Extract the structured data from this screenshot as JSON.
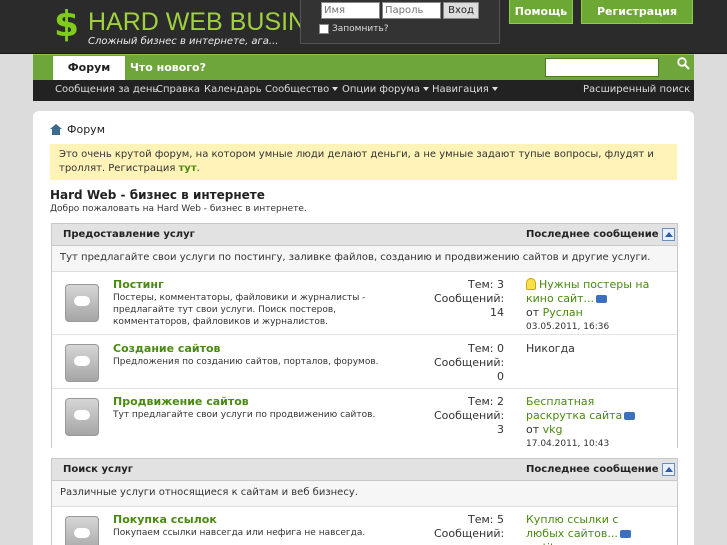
{
  "header": {
    "logo_symbol": "$",
    "site_name": "HARD WEB BUSINESS",
    "slogan": "Сложный бизнес в интернете, ага...",
    "login": {
      "user_placeholder": "Имя",
      "pass_placeholder": "Пароль",
      "submit": "Вход",
      "remember": "Запомнить?"
    },
    "help": "Помощь",
    "register": "Регистрация"
  },
  "nav": {
    "tabs": [
      "Форум",
      "Что нового?"
    ],
    "search_placeholder": "",
    "search_icon": "magnifier-icon",
    "sub": [
      "Сообщения за день",
      "Справка",
      "Календарь",
      "Сообщество",
      "Опции форума",
      "Навигация"
    ],
    "advanced_search": "Расширенный поиск"
  },
  "breadcrumb": "Форум",
  "notice": {
    "text": "Это очень крутой форум, на котором умные люди делают деньги, а не умные задают тупые вопросы, флудят и троллят. Регистрация ",
    "link": "тут",
    "tail": "."
  },
  "forum": {
    "title": "Hard Web - бизнес в интернете",
    "desc": "Добро пожаловать на Hard Web - бизнес в интернете."
  },
  "sections": [
    {
      "title": "Предоставление услуг",
      "last_label": "Последнее сообщение",
      "desc": "Тут предлагайте свои услуги по постингу, заливке файлов, созданию и продвижению сайтов и другие услуги.",
      "forums": [
        {
          "name": "Постинг",
          "desc": "Постеры, комментаторы, файловики и журналисты - предлагайте тут свои услуги. Поиск постеров, комментаторов, файловиков и журналистов.",
          "threads": "Тем: 3",
          "posts_label": "Сообщений:",
          "posts": "14",
          "last_title": "Нужны постеры на кино сайт...",
          "last_by": "от",
          "last_user": "Руслан",
          "last_date": "03.05.2011,",
          "last_time": "16:36"
        },
        {
          "name": "Создание сайтов",
          "desc": "Предложения по созданию сайтов, порталов, форумов.",
          "threads": "Тем: 0",
          "posts_label": "Сообщений:",
          "posts": "0",
          "never": "Никогда"
        },
        {
          "name": "Продвижение сайтов",
          "desc": "Тут предлагайте свои услуги по продвижению сайтов.",
          "threads": "Тем: 2",
          "posts_label": "Сообщений:",
          "posts": "3",
          "last_title": "Бесплатная раскрутка сайта",
          "last_by": "от",
          "last_user": "vkg",
          "last_date": "17.04.2011,",
          "last_time": "10:43"
        }
      ]
    },
    {
      "title": "Поиск услуг",
      "last_label": "Последнее сообщение",
      "desc": "Различные услуги относящиеся к сайтам и веб бизнесу.",
      "forums": [
        {
          "name": "Покупка ссылок",
          "desc": "Покупаем ссылки навсегда или нефига не навсегда.",
          "threads": "Тем: 5",
          "posts_label": "Сообщений:",
          "last_title": "Куплю ссылки с любых сайтов...",
          "last_by": "от",
          "last_user": "titov"
        }
      ]
    }
  ]
}
